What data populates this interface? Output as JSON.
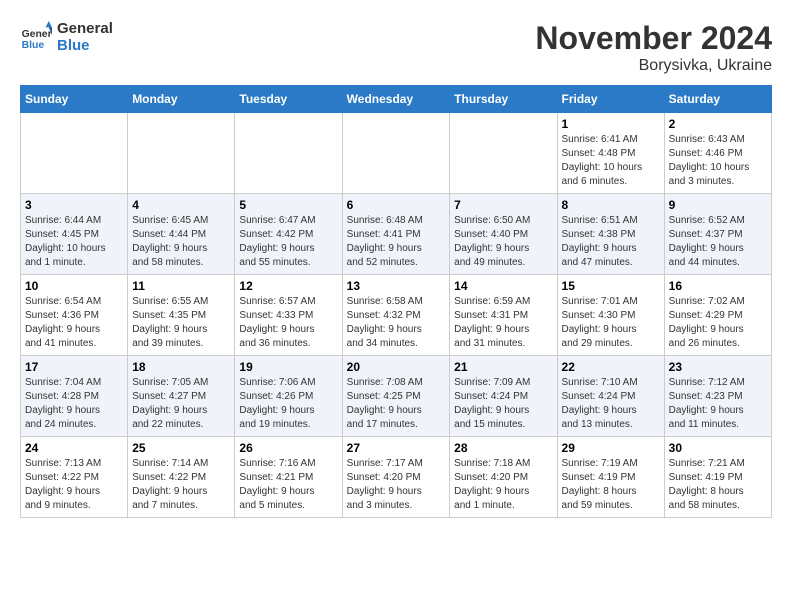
{
  "header": {
    "logo_line1": "General",
    "logo_line2": "Blue",
    "month_title": "November 2024",
    "subtitle": "Borysivka, Ukraine"
  },
  "weekdays": [
    "Sunday",
    "Monday",
    "Tuesday",
    "Wednesday",
    "Thursday",
    "Friday",
    "Saturday"
  ],
  "weeks": [
    [
      {
        "day": "",
        "info": ""
      },
      {
        "day": "",
        "info": ""
      },
      {
        "day": "",
        "info": ""
      },
      {
        "day": "",
        "info": ""
      },
      {
        "day": "",
        "info": ""
      },
      {
        "day": "1",
        "info": "Sunrise: 6:41 AM\nSunset: 4:48 PM\nDaylight: 10 hours\nand 6 minutes."
      },
      {
        "day": "2",
        "info": "Sunrise: 6:43 AM\nSunset: 4:46 PM\nDaylight: 10 hours\nand 3 minutes."
      }
    ],
    [
      {
        "day": "3",
        "info": "Sunrise: 6:44 AM\nSunset: 4:45 PM\nDaylight: 10 hours\nand 1 minute."
      },
      {
        "day": "4",
        "info": "Sunrise: 6:45 AM\nSunset: 4:44 PM\nDaylight: 9 hours\nand 58 minutes."
      },
      {
        "day": "5",
        "info": "Sunrise: 6:47 AM\nSunset: 4:42 PM\nDaylight: 9 hours\nand 55 minutes."
      },
      {
        "day": "6",
        "info": "Sunrise: 6:48 AM\nSunset: 4:41 PM\nDaylight: 9 hours\nand 52 minutes."
      },
      {
        "day": "7",
        "info": "Sunrise: 6:50 AM\nSunset: 4:40 PM\nDaylight: 9 hours\nand 49 minutes."
      },
      {
        "day": "8",
        "info": "Sunrise: 6:51 AM\nSunset: 4:38 PM\nDaylight: 9 hours\nand 47 minutes."
      },
      {
        "day": "9",
        "info": "Sunrise: 6:52 AM\nSunset: 4:37 PM\nDaylight: 9 hours\nand 44 minutes."
      }
    ],
    [
      {
        "day": "10",
        "info": "Sunrise: 6:54 AM\nSunset: 4:36 PM\nDaylight: 9 hours\nand 41 minutes."
      },
      {
        "day": "11",
        "info": "Sunrise: 6:55 AM\nSunset: 4:35 PM\nDaylight: 9 hours\nand 39 minutes."
      },
      {
        "day": "12",
        "info": "Sunrise: 6:57 AM\nSunset: 4:33 PM\nDaylight: 9 hours\nand 36 minutes."
      },
      {
        "day": "13",
        "info": "Sunrise: 6:58 AM\nSunset: 4:32 PM\nDaylight: 9 hours\nand 34 minutes."
      },
      {
        "day": "14",
        "info": "Sunrise: 6:59 AM\nSunset: 4:31 PM\nDaylight: 9 hours\nand 31 minutes."
      },
      {
        "day": "15",
        "info": "Sunrise: 7:01 AM\nSunset: 4:30 PM\nDaylight: 9 hours\nand 29 minutes."
      },
      {
        "day": "16",
        "info": "Sunrise: 7:02 AM\nSunset: 4:29 PM\nDaylight: 9 hours\nand 26 minutes."
      }
    ],
    [
      {
        "day": "17",
        "info": "Sunrise: 7:04 AM\nSunset: 4:28 PM\nDaylight: 9 hours\nand 24 minutes."
      },
      {
        "day": "18",
        "info": "Sunrise: 7:05 AM\nSunset: 4:27 PM\nDaylight: 9 hours\nand 22 minutes."
      },
      {
        "day": "19",
        "info": "Sunrise: 7:06 AM\nSunset: 4:26 PM\nDaylight: 9 hours\nand 19 minutes."
      },
      {
        "day": "20",
        "info": "Sunrise: 7:08 AM\nSunset: 4:25 PM\nDaylight: 9 hours\nand 17 minutes."
      },
      {
        "day": "21",
        "info": "Sunrise: 7:09 AM\nSunset: 4:24 PM\nDaylight: 9 hours\nand 15 minutes."
      },
      {
        "day": "22",
        "info": "Sunrise: 7:10 AM\nSunset: 4:24 PM\nDaylight: 9 hours\nand 13 minutes."
      },
      {
        "day": "23",
        "info": "Sunrise: 7:12 AM\nSunset: 4:23 PM\nDaylight: 9 hours\nand 11 minutes."
      }
    ],
    [
      {
        "day": "24",
        "info": "Sunrise: 7:13 AM\nSunset: 4:22 PM\nDaylight: 9 hours\nand 9 minutes."
      },
      {
        "day": "25",
        "info": "Sunrise: 7:14 AM\nSunset: 4:22 PM\nDaylight: 9 hours\nand 7 minutes."
      },
      {
        "day": "26",
        "info": "Sunrise: 7:16 AM\nSunset: 4:21 PM\nDaylight: 9 hours\nand 5 minutes."
      },
      {
        "day": "27",
        "info": "Sunrise: 7:17 AM\nSunset: 4:20 PM\nDaylight: 9 hours\nand 3 minutes."
      },
      {
        "day": "28",
        "info": "Sunrise: 7:18 AM\nSunset: 4:20 PM\nDaylight: 9 hours\nand 1 minute."
      },
      {
        "day": "29",
        "info": "Sunrise: 7:19 AM\nSunset: 4:19 PM\nDaylight: 8 hours\nand 59 minutes."
      },
      {
        "day": "30",
        "info": "Sunrise: 7:21 AM\nSunset: 4:19 PM\nDaylight: 8 hours\nand 58 minutes."
      }
    ]
  ]
}
